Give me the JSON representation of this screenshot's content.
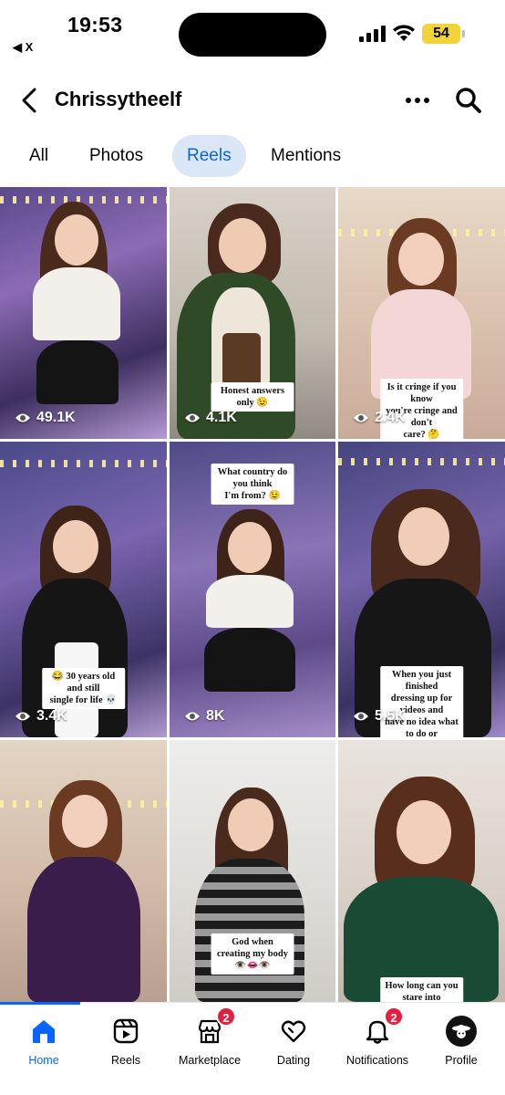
{
  "status_bar": {
    "time": "19:53",
    "back_app": "◀ X",
    "battery": "54",
    "icons": [
      "signal-icon",
      "wifi-icon",
      "battery-icon"
    ]
  },
  "header": {
    "title": "Chrissytheelf",
    "icons": [
      "back-arrow-icon",
      "more-icon",
      "search-icon"
    ]
  },
  "tabs": [
    {
      "label": "All",
      "active": false
    },
    {
      "label": "Photos",
      "active": false
    },
    {
      "label": "Reels",
      "active": true
    },
    {
      "label": "Mentions",
      "active": false
    }
  ],
  "reels": [
    {
      "views": "49.1K",
      "caption": ""
    },
    {
      "views": "4.1K",
      "caption": "Honest answers only 😉"
    },
    {
      "views": "2.4K",
      "caption": "Is it cringe if you know\nyou're cringe and don't\ncare? 🤔"
    },
    {
      "views": "3.4K",
      "caption": "😂 30 years old and still\nsingle for life 💀"
    },
    {
      "views": "8K",
      "caption": "What country do you think\nI'm from? 😉"
    },
    {
      "views": "5.5K",
      "caption": "When you just finished\ndressing up for videos and\nhave no idea what to do or\nthe energy to make them"
    },
    {
      "views": "",
      "caption": ""
    },
    {
      "views": "",
      "caption": "God when creating my body\n👁️👄👁️"
    },
    {
      "views": "",
      "caption": "How long can you stare into\nmy eyes 👁️👄👁️"
    }
  ],
  "bottom_nav": [
    {
      "label": "Home",
      "icon": "home-icon",
      "active": true,
      "badge": ""
    },
    {
      "label": "Reels",
      "icon": "reels-icon",
      "active": false,
      "badge": ""
    },
    {
      "label": "Marketplace",
      "icon": "marketplace-icon",
      "active": false,
      "badge": "2"
    },
    {
      "label": "Dating",
      "icon": "dating-icon",
      "active": false,
      "badge": ""
    },
    {
      "label": "Notifications",
      "icon": "bell-icon",
      "active": false,
      "badge": "2"
    },
    {
      "label": "Profile",
      "icon": "profile-avatar",
      "active": false,
      "badge": ""
    }
  ],
  "colors": {
    "accent": "#0866ff",
    "tab_active_bg": "#dbe7f6",
    "badge": "#e41e3f",
    "battery": "#f3d33a"
  }
}
